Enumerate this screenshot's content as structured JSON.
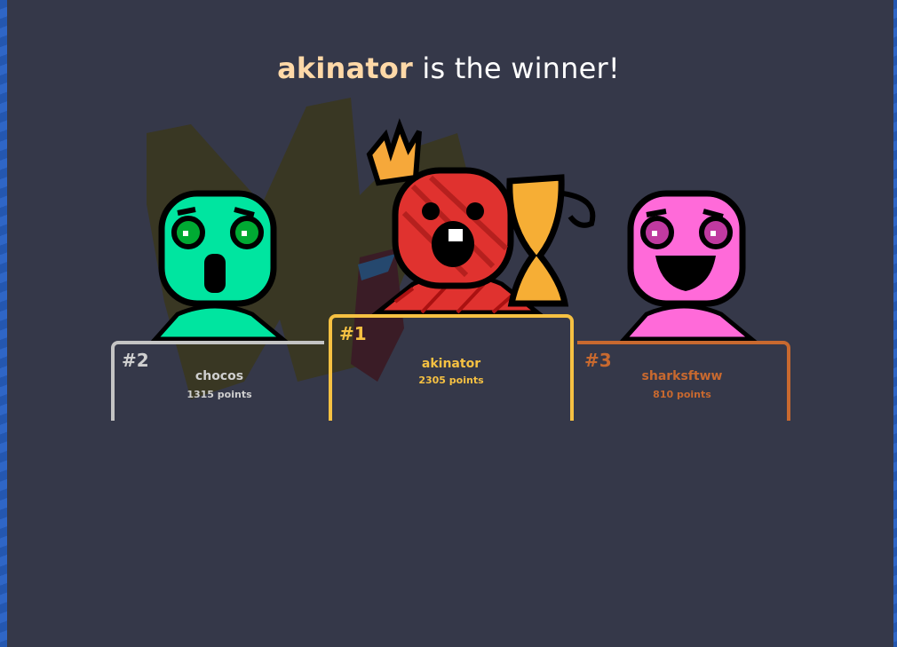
{
  "title": {
    "winner": "akinator",
    "suffix": " is the winner!"
  },
  "podium": [
    {
      "rank": "#2",
      "name": "chocos",
      "points": "1315 points",
      "color": "#c4c4c4",
      "avatar_color": "#00e5a0"
    },
    {
      "rank": "#1",
      "name": "akinator",
      "points": "2305 points",
      "color": "#f6c142",
      "avatar_color": "#e0322f"
    },
    {
      "rank": "#3",
      "name": "sharksftww",
      "points": "810 points",
      "color": "#c8692f",
      "avatar_color": "#ff6ad9"
    }
  ],
  "icons": [
    "crown-icon",
    "trophy-icon"
  ]
}
